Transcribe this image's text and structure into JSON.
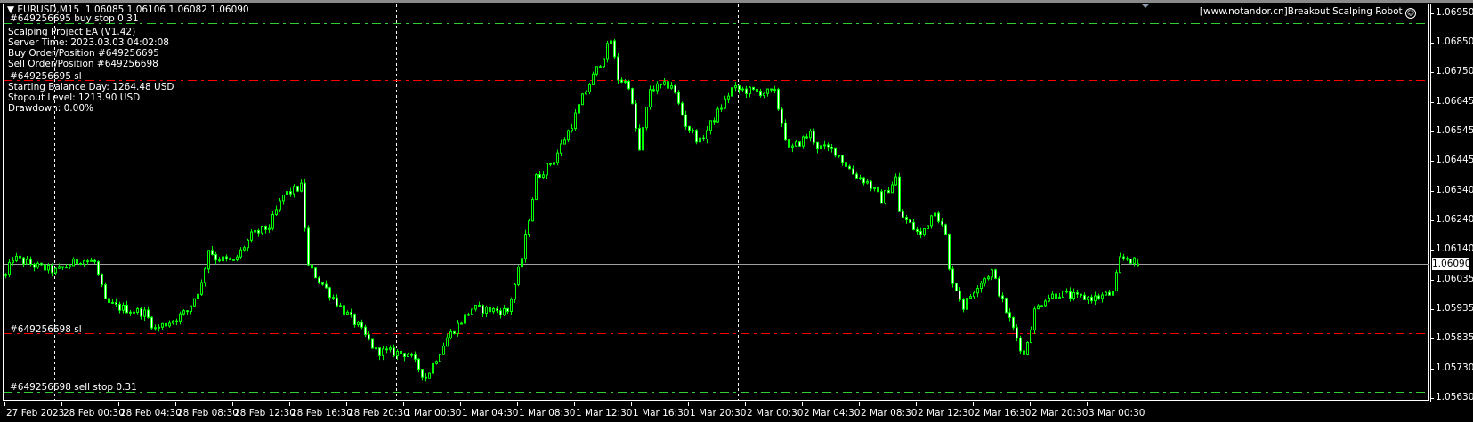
{
  "header": {
    "symbol": "EURUSD,M15",
    "ohlc": "1.06085 1.06106 1.06082 1.06090",
    "robot_label": "[www.notandor.cn]Breakout Scalping Robot"
  },
  "overlay": {
    "buy_stop": "#649256695 buy stop 0.31",
    "lines": [
      "Scalping Project EA (V1.42)",
      "Server Time: 2023.03.03 04:02:08",
      "Buy Order/Position #649256695",
      "Sell Order/Position #649256698"
    ],
    "buy_sl": "#649256695 sl",
    "lines2": [
      "Starting Balance Day: 1264.48 USD",
      "Stopout Level: 1213.90 USD",
      "Drawdown: 0.00%"
    ],
    "sell_sl": "#649256698 sl",
    "sell_stop": "#649256698 sell stop 0.31"
  },
  "colors": {
    "bull": "#00ff00",
    "buy_line": "#32cd32",
    "sl_line": "#ff0000",
    "current_line": "#a0a0a0",
    "grid": "#ffffff"
  },
  "chart_data": {
    "type": "candlestick",
    "symbol": "EURUSD",
    "timeframe": "M15",
    "ylim": [
      1.0563,
      1.0695
    ],
    "current_price": "1.06090",
    "last_bar": {
      "open": 1.06085,
      "high": 1.06106,
      "low": 1.06082,
      "close": 1.0609
    },
    "levels": {
      "buy_stop": 1.06916,
      "buy_sl": 1.06721,
      "sell_sl": 1.05852,
      "sell_stop": 1.05651
    },
    "price_ticks": [
      "1.06950",
      "1.06850",
      "1.06750",
      "1.06645",
      "1.06545",
      "1.06445",
      "1.06340",
      "1.06240",
      "1.06140",
      "1.06035",
      "1.05935",
      "1.05835",
      "1.05730",
      "1.05630"
    ],
    "time_ticks": [
      "27 Feb 2023",
      "28 Feb 00:30",
      "28 Feb 04:30",
      "28 Feb 08:30",
      "28 Feb 12:30",
      "28 Feb 16:30",
      "28 Feb 20:30",
      "1 Mar 00:30",
      "1 Mar 04:30",
      "1 Mar 08:30",
      "1 Mar 12:30",
      "1 Mar 16:30",
      "1 Mar 20:30",
      "2 Mar 00:30",
      "2 Mar 04:30",
      "2 Mar 08:30",
      "2 Mar 12:30",
      "2 Mar 16:30",
      "2 Mar 20:30",
      "3 Mar 00:30"
    ],
    "bars_per_time_tick": 16,
    "day_separator_bars": [
      14,
      110,
      206,
      302
    ],
    "approx_close_path": [
      [
        0,
        1.0605
      ],
      [
        2,
        1.06111
      ],
      [
        9,
        1.06081
      ],
      [
        14,
        1.06065
      ],
      [
        21,
        1.06105
      ],
      [
        25,
        1.06096
      ],
      [
        28,
        1.05959
      ],
      [
        31,
        1.05943
      ],
      [
        39,
        1.05922
      ],
      [
        42,
        1.05867
      ],
      [
        47,
        1.05898
      ],
      [
        51,
        1.05928
      ],
      [
        55,
        1.0602
      ],
      [
        57,
        1.06142
      ],
      [
        59,
        1.06111
      ],
      [
        64,
        1.06096
      ],
      [
        69,
        1.06187
      ],
      [
        74,
        1.06218
      ],
      [
        78,
        1.06325
      ],
      [
        83,
        1.06355
      ],
      [
        85,
        1.06081
      ],
      [
        89,
        1.0602
      ],
      [
        94,
        1.05943
      ],
      [
        99,
        1.05876
      ],
      [
        104,
        1.05791
      ],
      [
        113,
        1.05782
      ],
      [
        118,
        1.05699
      ],
      [
        124,
        1.05837
      ],
      [
        131,
        1.05937
      ],
      [
        141,
        1.05928
      ],
      [
        145,
        1.06111
      ],
      [
        149,
        1.06386
      ],
      [
        154,
        1.06447
      ],
      [
        159,
        1.06569
      ],
      [
        162,
        1.0666
      ],
      [
        167,
        1.06782
      ],
      [
        170,
        1.06858
      ],
      [
        172,
        1.06727
      ],
      [
        175,
        1.06706
      ],
      [
        178,
        1.06477
      ],
      [
        181,
        1.06691
      ],
      [
        187,
        1.06706
      ],
      [
        191,
        1.06569
      ],
      [
        195,
        1.06508
      ],
      [
        198,
        1.06569
      ],
      [
        204,
        1.06691
      ],
      [
        210,
        1.06682
      ],
      [
        216,
        1.06676
      ],
      [
        220,
        1.06477
      ],
      [
        226,
        1.06538
      ],
      [
        228,
        1.06493
      ],
      [
        233,
        1.06477
      ],
      [
        238,
        1.06401
      ],
      [
        242,
        1.0637
      ],
      [
        246,
        1.0631
      ],
      [
        250,
        1.06386
      ],
      [
        251,
        1.06264
      ],
      [
        257,
        1.06187
      ],
      [
        261,
        1.06279
      ],
      [
        264,
        1.06187
      ],
      [
        265,
        1.06065
      ],
      [
        269,
        1.05943
      ],
      [
        273,
        1.0602
      ],
      [
        277,
        1.06065
      ],
      [
        280,
        1.05959
      ],
      [
        285,
        1.05806
      ],
      [
        286,
        1.05776
      ],
      [
        289,
        1.05928
      ],
      [
        292,
        1.05974
      ],
      [
        296,
        1.05989
      ],
      [
        301,
        1.05974
      ],
      [
        306,
        1.05974
      ],
      [
        311,
        1.05989
      ],
      [
        313,
        1.06105
      ],
      [
        315,
        1.06111
      ],
      [
        318,
        1.0609
      ]
    ]
  }
}
